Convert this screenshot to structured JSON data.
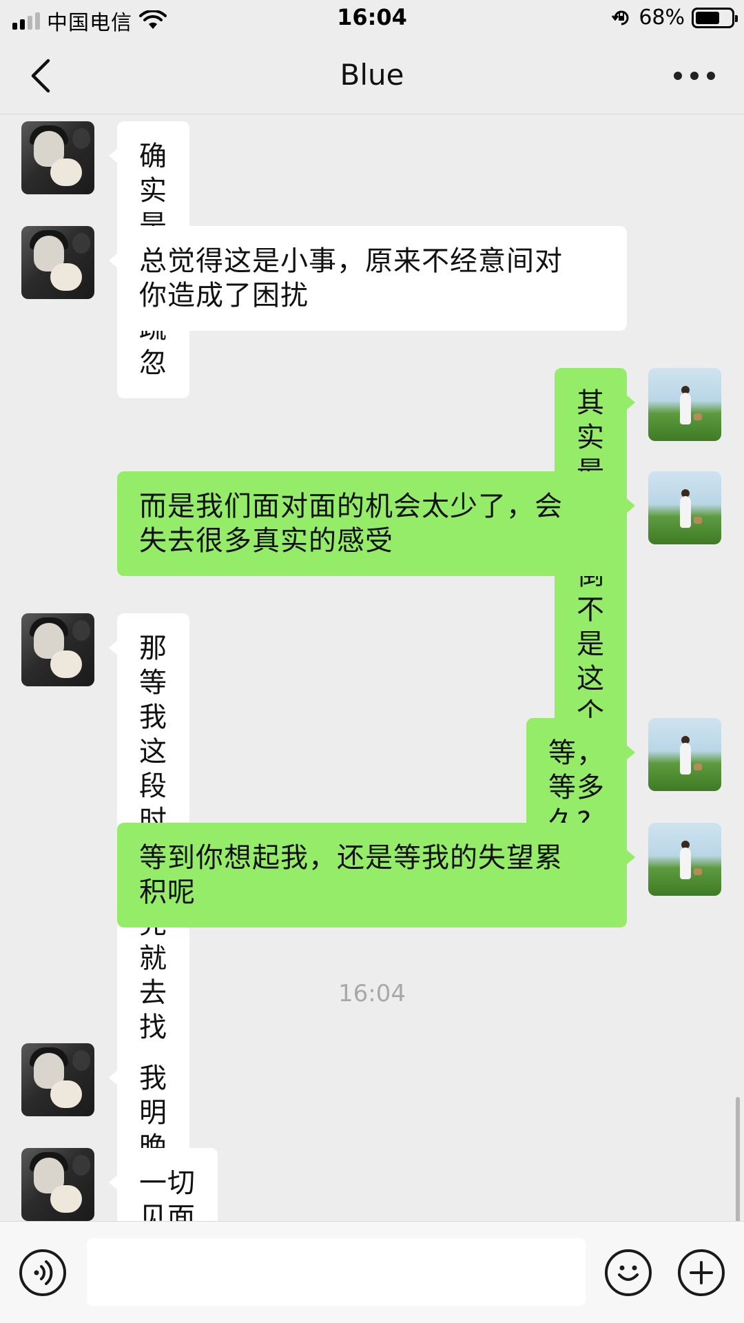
{
  "status_bar": {
    "carrier": "中国电信",
    "time": "16:04",
    "battery": "68%",
    "battery_level": 0.68
  },
  "nav": {
    "title": "Blue",
    "back_icon": "chevron-left-icon",
    "more_icon": "more-dots-icon"
  },
  "messages": [
    {
      "sender": "them",
      "text": "确实是我的疏忽"
    },
    {
      "sender": "them",
      "text_lines": [
        "总觉得这是小事，原来不经意间对",
        "你造成了困扰"
      ]
    },
    {
      "sender": "me",
      "text": "其实最重要倒不是这个点"
    },
    {
      "sender": "me",
      "text_lines": [
        "而是我们面对面的机会太少了，会",
        "失去很多真实的感受"
      ]
    },
    {
      "sender": "them",
      "text": "那等我这段时间忙完就去找你好嘛"
    },
    {
      "sender": "me",
      "text": "等，等多久?"
    },
    {
      "sender": "me",
      "text_lines": [
        "等到你想起我，还是等我的失望累",
        "积呢"
      ]
    },
    {
      "timestamp": "16:04"
    },
    {
      "sender": "them",
      "text": "我明晚忙完就飞武汉"
    },
    {
      "sender": "them",
      "text": "一切见面说，好嘛"
    }
  ],
  "colors": {
    "background": "#EDEDED",
    "bubble_me": "#95EC69",
    "bubble_them": "#FFFFFF",
    "timestamp": "#A8A8A8"
  },
  "input_bar": {
    "voice_icon": "voice-icon",
    "emoji_icon": "emoji-icon",
    "plus_icon": "plus-icon",
    "placeholder": ""
  }
}
